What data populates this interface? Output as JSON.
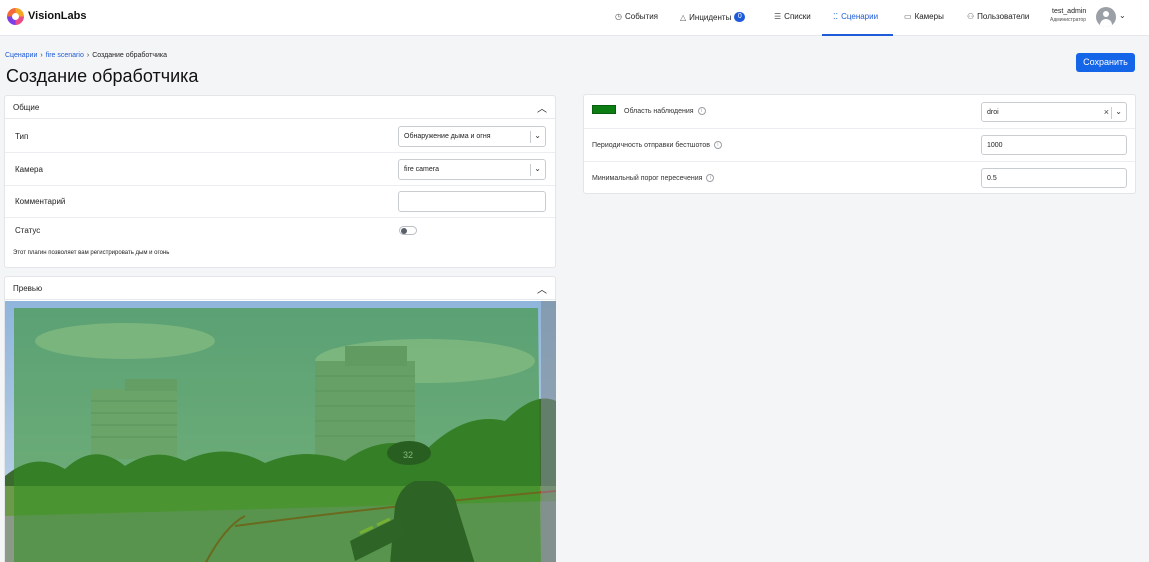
{
  "app": {
    "brand": "VisionLabs"
  },
  "nav": {
    "items": [
      {
        "label": "События",
        "icon": "clock-icon"
      },
      {
        "label": "Инциденты",
        "icon": "warning-icon",
        "badge": "0"
      },
      {
        "label": "Списки",
        "icon": "list-icon"
      },
      {
        "label": "Сценарии",
        "icon": "scenario-icon",
        "active": true
      },
      {
        "label": "Камеры",
        "icon": "camera-icon"
      },
      {
        "label": "Пользователи",
        "icon": "users-icon"
      }
    ]
  },
  "user": {
    "name": "test_admin",
    "role": "Администратор"
  },
  "breadcrumb": {
    "items": [
      "Сценарии",
      "fire scenario",
      "Создание обработчика"
    ],
    "separator": "›"
  },
  "page": {
    "title": "Создание обработчика",
    "save_label": "Сохранить"
  },
  "general": {
    "title": "Общие",
    "type_label": "Тип",
    "type_value": "Обнаружение дыма и огня",
    "camera_label": "Камера",
    "camera_value": "fire camera",
    "comment_label": "Комментарий",
    "comment_value": "",
    "status_label": "Статус",
    "status_on": false,
    "description": "Этот плагин позволяет вам регистрировать дым и огонь"
  },
  "preview": {
    "title": "Превью"
  },
  "settings": {
    "area_label": "Область наблюдения",
    "area_color": "#0b7d12",
    "area_value": "droi",
    "period_label": "Периодичность отправки бестшотов",
    "period_value": "1000",
    "threshold_label": "Минимальный порог пересечения",
    "threshold_value": "0.5"
  },
  "colors": {
    "accent": "#1e5bd8",
    "button": "#1565e9",
    "overlay": "#2f8f1f"
  }
}
